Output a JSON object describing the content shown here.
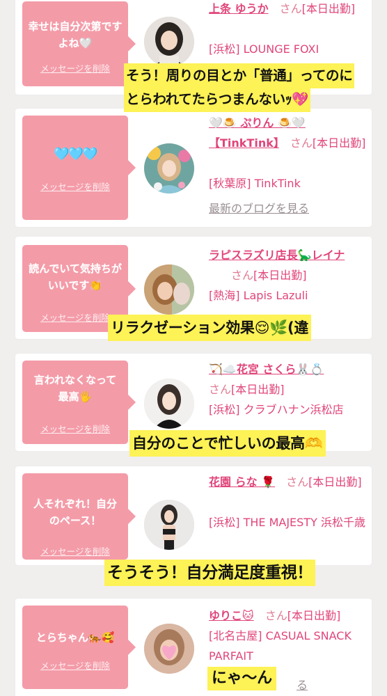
{
  "cards": [
    {
      "message": "幸せは自分次第ですよね🤍",
      "delete_label": "メッセージを削除",
      "name": "上条 ゆうか",
      "honorific": "さん",
      "status": "[本日出勤]",
      "shop": "[浜松] LOUNGE FOXI"
    },
    {
      "message": "🩵🩵🩵",
      "delete_label": "メッセージを削除",
      "name_line1": "🤍🍮 ぷりん 🍮🤍",
      "name_line2": "【TinkTink】",
      "honorific": "さん",
      "status": "[本日出勤]",
      "shop": "[秋葉原] TinkTink",
      "blog_link": "最新のブログを見る"
    },
    {
      "message": "読んでいて気持ちがいいです👏",
      "delete_label": "メッセージを削除",
      "name": "ラピスラズリ店長🦕レイナ",
      "honorific": "さん",
      "status": "[本日出勤]",
      "shop": "[熱海] Lapis Lazuli"
    },
    {
      "message": "言われなくなって最高🖐",
      "delete_label": "メッセージを削除",
      "name": "🏹☁️花宮 さくら🐰💍",
      "honorific": "さん",
      "status": "[本日出勤]",
      "shop": "[浜松] クラブハナン浜松店"
    },
    {
      "message": "人それぞれ！自分のペース！",
      "delete_label": "メッセージを削除",
      "name": "花園 らな 🌹",
      "honorific": "さん",
      "status": "[本日出勤]",
      "shop": "[浜松] THE MAJESTY 浜松千歳"
    },
    {
      "message": "とらちゃん🐅🥰",
      "delete_label": "メッセージを削除",
      "name": "ゆりこ🐱",
      "honorific": "さん",
      "status": "[本日出勤]",
      "shop": "[北名古屋] CASUAL SNACK PARFAIT",
      "blog_partial": "る"
    }
  ],
  "captions": [
    "そう！周りの目とか「普通」ってのに",
    "とらわれてたらつまんないｯ💖",
    "リラクゼーション効果😌🌿(違",
    "自分のことで忙しいの最高🫶",
    "そうそう！自分満足度重視！",
    "にゃ〜ん"
  ],
  "colors": {
    "bubble": "#f49ba8",
    "name_pink": "#e0457b",
    "highlight": "#fdf256",
    "background": "#f1eeee"
  }
}
